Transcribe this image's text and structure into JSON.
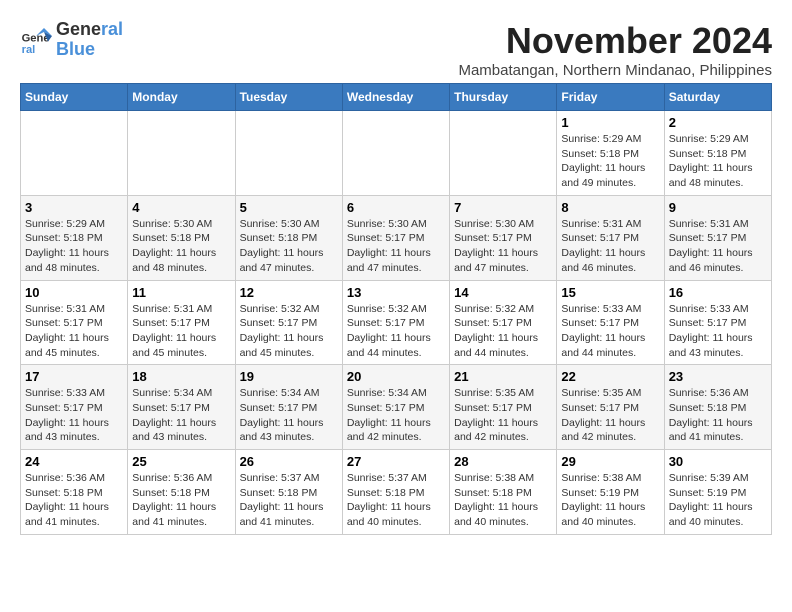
{
  "logo": {
    "line1": "General",
    "line2": "Blue"
  },
  "title": "November 2024",
  "subtitle": "Mambatangan, Northern Mindanao, Philippines",
  "days_of_week": [
    "Sunday",
    "Monday",
    "Tuesday",
    "Wednesday",
    "Thursday",
    "Friday",
    "Saturday"
  ],
  "weeks": [
    [
      {
        "day": "",
        "info": ""
      },
      {
        "day": "",
        "info": ""
      },
      {
        "day": "",
        "info": ""
      },
      {
        "day": "",
        "info": ""
      },
      {
        "day": "",
        "info": ""
      },
      {
        "day": "1",
        "info": "Sunrise: 5:29 AM\nSunset: 5:18 PM\nDaylight: 11 hours\nand 49 minutes."
      },
      {
        "day": "2",
        "info": "Sunrise: 5:29 AM\nSunset: 5:18 PM\nDaylight: 11 hours\nand 48 minutes."
      }
    ],
    [
      {
        "day": "3",
        "info": "Sunrise: 5:29 AM\nSunset: 5:18 PM\nDaylight: 11 hours\nand 48 minutes."
      },
      {
        "day": "4",
        "info": "Sunrise: 5:30 AM\nSunset: 5:18 PM\nDaylight: 11 hours\nand 48 minutes."
      },
      {
        "day": "5",
        "info": "Sunrise: 5:30 AM\nSunset: 5:18 PM\nDaylight: 11 hours\nand 47 minutes."
      },
      {
        "day": "6",
        "info": "Sunrise: 5:30 AM\nSunset: 5:17 PM\nDaylight: 11 hours\nand 47 minutes."
      },
      {
        "day": "7",
        "info": "Sunrise: 5:30 AM\nSunset: 5:17 PM\nDaylight: 11 hours\nand 47 minutes."
      },
      {
        "day": "8",
        "info": "Sunrise: 5:31 AM\nSunset: 5:17 PM\nDaylight: 11 hours\nand 46 minutes."
      },
      {
        "day": "9",
        "info": "Sunrise: 5:31 AM\nSunset: 5:17 PM\nDaylight: 11 hours\nand 46 minutes."
      }
    ],
    [
      {
        "day": "10",
        "info": "Sunrise: 5:31 AM\nSunset: 5:17 PM\nDaylight: 11 hours\nand 45 minutes."
      },
      {
        "day": "11",
        "info": "Sunrise: 5:31 AM\nSunset: 5:17 PM\nDaylight: 11 hours\nand 45 minutes."
      },
      {
        "day": "12",
        "info": "Sunrise: 5:32 AM\nSunset: 5:17 PM\nDaylight: 11 hours\nand 45 minutes."
      },
      {
        "day": "13",
        "info": "Sunrise: 5:32 AM\nSunset: 5:17 PM\nDaylight: 11 hours\nand 44 minutes."
      },
      {
        "day": "14",
        "info": "Sunrise: 5:32 AM\nSunset: 5:17 PM\nDaylight: 11 hours\nand 44 minutes."
      },
      {
        "day": "15",
        "info": "Sunrise: 5:33 AM\nSunset: 5:17 PM\nDaylight: 11 hours\nand 44 minutes."
      },
      {
        "day": "16",
        "info": "Sunrise: 5:33 AM\nSunset: 5:17 PM\nDaylight: 11 hours\nand 43 minutes."
      }
    ],
    [
      {
        "day": "17",
        "info": "Sunrise: 5:33 AM\nSunset: 5:17 PM\nDaylight: 11 hours\nand 43 minutes."
      },
      {
        "day": "18",
        "info": "Sunrise: 5:34 AM\nSunset: 5:17 PM\nDaylight: 11 hours\nand 43 minutes."
      },
      {
        "day": "19",
        "info": "Sunrise: 5:34 AM\nSunset: 5:17 PM\nDaylight: 11 hours\nand 43 minutes."
      },
      {
        "day": "20",
        "info": "Sunrise: 5:34 AM\nSunset: 5:17 PM\nDaylight: 11 hours\nand 42 minutes."
      },
      {
        "day": "21",
        "info": "Sunrise: 5:35 AM\nSunset: 5:17 PM\nDaylight: 11 hours\nand 42 minutes."
      },
      {
        "day": "22",
        "info": "Sunrise: 5:35 AM\nSunset: 5:17 PM\nDaylight: 11 hours\nand 42 minutes."
      },
      {
        "day": "23",
        "info": "Sunrise: 5:36 AM\nSunset: 5:18 PM\nDaylight: 11 hours\nand 41 minutes."
      }
    ],
    [
      {
        "day": "24",
        "info": "Sunrise: 5:36 AM\nSunset: 5:18 PM\nDaylight: 11 hours\nand 41 minutes."
      },
      {
        "day": "25",
        "info": "Sunrise: 5:36 AM\nSunset: 5:18 PM\nDaylight: 11 hours\nand 41 minutes."
      },
      {
        "day": "26",
        "info": "Sunrise: 5:37 AM\nSunset: 5:18 PM\nDaylight: 11 hours\nand 41 minutes."
      },
      {
        "day": "27",
        "info": "Sunrise: 5:37 AM\nSunset: 5:18 PM\nDaylight: 11 hours\nand 40 minutes."
      },
      {
        "day": "28",
        "info": "Sunrise: 5:38 AM\nSunset: 5:18 PM\nDaylight: 11 hours\nand 40 minutes."
      },
      {
        "day": "29",
        "info": "Sunrise: 5:38 AM\nSunset: 5:19 PM\nDaylight: 11 hours\nand 40 minutes."
      },
      {
        "day": "30",
        "info": "Sunrise: 5:39 AM\nSunset: 5:19 PM\nDaylight: 11 hours\nand 40 minutes."
      }
    ]
  ]
}
